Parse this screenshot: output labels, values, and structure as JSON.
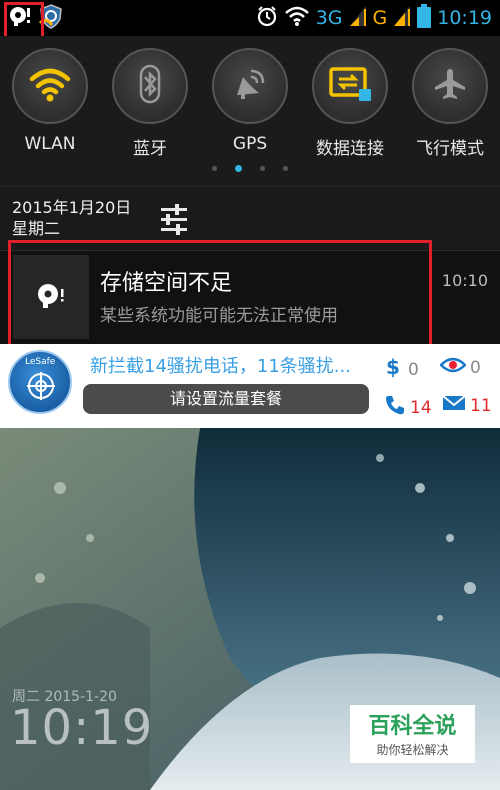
{
  "statusbar": {
    "network_3g": "3G",
    "network_g": "G",
    "time": "10:19",
    "accent": "#33b5e5"
  },
  "quick_settings": {
    "items": [
      {
        "label": "WLAN",
        "icon": "wifi-icon"
      },
      {
        "label": "蓝牙",
        "icon": "bluetooth-icon"
      },
      {
        "label": "GPS",
        "icon": "gps-icon"
      },
      {
        "label": "数据连接",
        "icon": "data-connection-icon"
      },
      {
        "label": "飞行模式",
        "icon": "airplane-icon"
      }
    ],
    "page_count": 4,
    "active_page": 2
  },
  "date": {
    "date": "2015年1月20日",
    "weekday": "星期二"
  },
  "notification": {
    "title": "存储空间不足",
    "subtitle": "某些系统功能可能无法正常使用",
    "time": "10:10"
  },
  "lesafe": {
    "logo_text": "LeSafe",
    "headline": "新拦截14骚扰电话，11条骚扰...",
    "button_label": "请设置流量套餐",
    "money_count": "0",
    "privacy_count": "0",
    "call_count": "14",
    "sms_count": "11"
  },
  "lockscreen": {
    "date": "周二 2015-1-20",
    "time": "10:19"
  },
  "watermark": {
    "title": "百科全说",
    "subtitle": "助你轻松解决"
  }
}
